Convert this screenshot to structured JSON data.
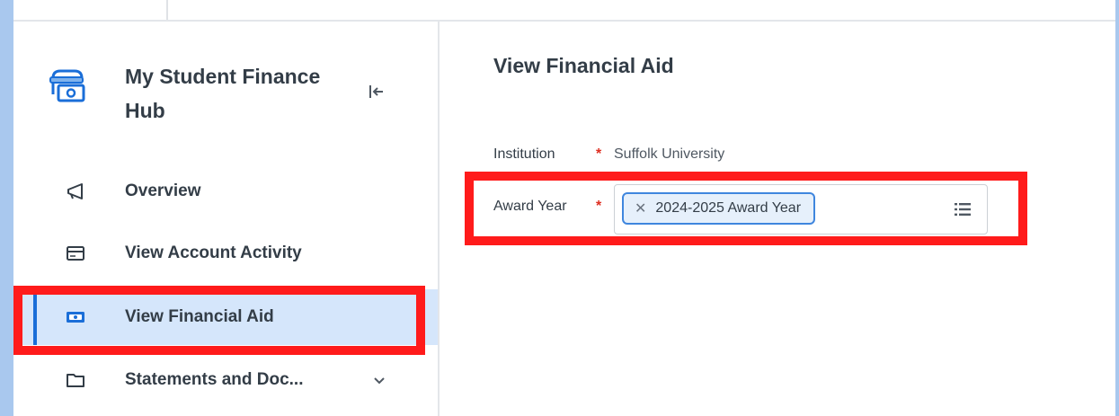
{
  "sidebar": {
    "hub_title": "My Student Finance Hub",
    "hub_icon": "student-finance-icon",
    "collapse_icon": "collapse-left-icon",
    "items": [
      {
        "label": "Overview",
        "icon": "megaphone-icon",
        "active": false
      },
      {
        "label": "View Account Activity",
        "icon": "card-icon",
        "active": false
      },
      {
        "label": "View Financial Aid",
        "icon": "money-icon",
        "active": true
      },
      {
        "label": "Statements and Doc...",
        "icon": "folder-icon",
        "active": false,
        "expandable": true
      }
    ]
  },
  "main": {
    "page_title": "View Financial Aid",
    "fields": {
      "institution": {
        "label": "Institution",
        "required": true,
        "value": "Suffolk University"
      },
      "award_year": {
        "label": "Award Year",
        "required": true,
        "selected": "2024-2025 Award Year"
      }
    }
  },
  "colors": {
    "background": "#a9c8ee",
    "highlight": "#ff1b1b",
    "active_nav_bg": "#d5e6fb",
    "accent": "#1a6ed8",
    "required": "#de2e21"
  }
}
